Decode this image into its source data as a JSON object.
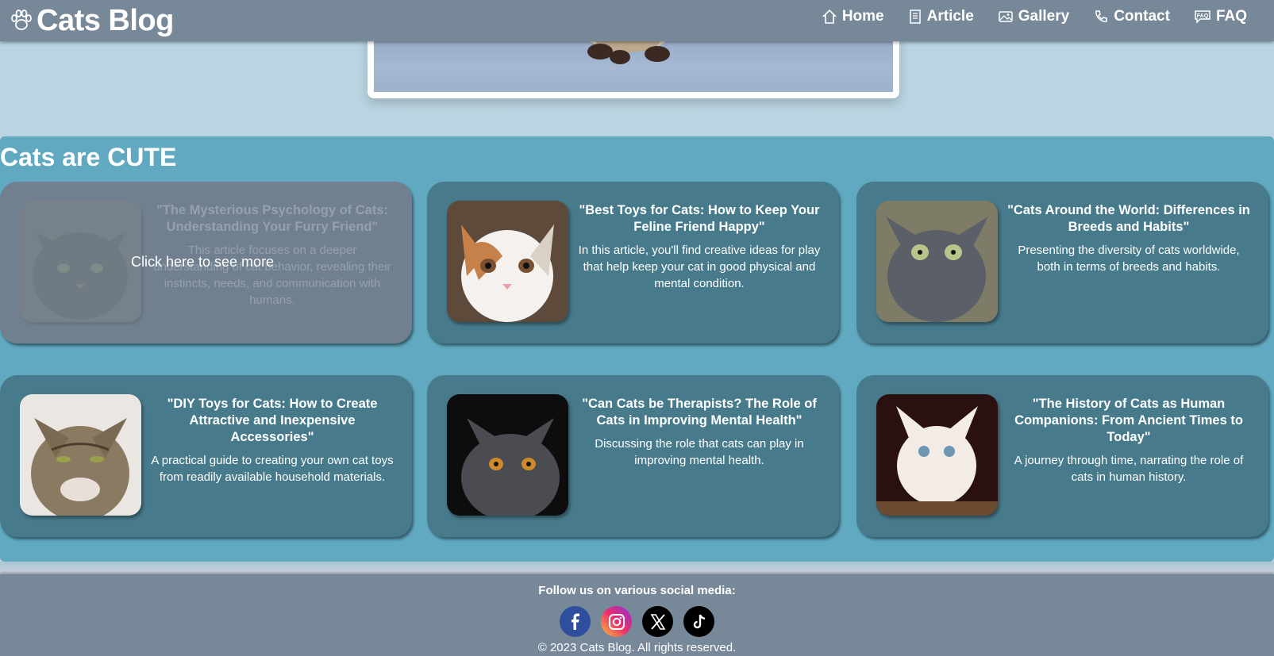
{
  "navbar": {
    "brand": "Cats Blog",
    "links": [
      {
        "label": "Home",
        "icon": "home-icon"
      },
      {
        "label": "Article",
        "icon": "document-icon"
      },
      {
        "label": "Gallery",
        "icon": "image-icon"
      },
      {
        "label": "Contact",
        "icon": "phone-icon"
      },
      {
        "label": "FAQ",
        "icon": "faq-icon"
      }
    ]
  },
  "section": {
    "title": "Cats are CUTE",
    "overlay_label": "Click here to see more",
    "cards": [
      {
        "title": "\"The Mysterious Psychology of Cats: Understanding Your Furry Friend\"",
        "desc": "This article focuses on a deeper understanding of cat behavior, revealing their instincts, needs, and communication with humans."
      },
      {
        "title": "\"Best Toys for Cats: How to Keep Your Feline Friend Happy\"",
        "desc": "In this article, you'll find creative ideas for play that help keep your cat in good physical and mental condition."
      },
      {
        "title": "\"Cats Around the World: Differences in Breeds and Habits\"",
        "desc": "Presenting the diversity of cats worldwide, both in terms of breeds and habits."
      },
      {
        "title": "\"DIY Toys for Cats: How to Create Attractive and Inexpensive Accessories\"",
        "desc": "A practical guide to creating your own cat toys from readily available household materials."
      },
      {
        "title": "\"Can Cats be Therapists? The Role of Cats in Improving Mental Health\"",
        "desc": "Discussing the role that cats can play in improving mental health."
      },
      {
        "title": "\"The History of Cats as Human Companions: From Ancient Times to Today\"",
        "desc": "A journey through time, narrating the role of cats in human history."
      }
    ]
  },
  "footer": {
    "follow": "Follow us on various social media:",
    "socials": [
      "facebook-icon",
      "instagram-icon",
      "x-icon",
      "tiktok-icon"
    ],
    "copyright": "© 2023 Cats Blog. All rights reserved."
  },
  "colors": {
    "navbar": "#778899",
    "section": "#60a9c1",
    "card": "#477b8c"
  }
}
